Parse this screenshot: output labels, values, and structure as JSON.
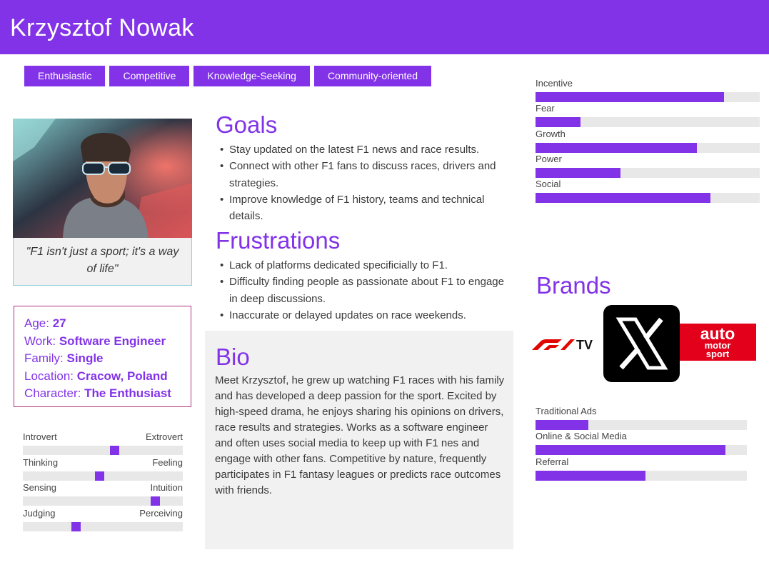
{
  "persona": {
    "name": "Krzysztof Nowak"
  },
  "tags": [
    "Enthusiastic",
    "Competitive",
    "Knowledge-Seeking",
    "Community-oriented"
  ],
  "quote": "\"F1 isn't just a sport; it's a way of life\"",
  "facts": {
    "age_label": "Age: ",
    "age": "27",
    "work_label": "Work: ",
    "work": "Software Engineer",
    "family_label": "Family: ",
    "family": "Single",
    "location_label": "Location: ",
    "location": "Cracow, Poland",
    "character_label": "Character: ",
    "character": "The Enthusiast"
  },
  "personality": [
    {
      "left": "Introvert",
      "right": "Extrovert",
      "value": 0.58
    },
    {
      "left": "Thinking",
      "right": "Feeling",
      "value": 0.48
    },
    {
      "left": "Sensing",
      "right": "Intuition",
      "value": 0.85
    },
    {
      "left": "Judging",
      "right": "Perceiving",
      "value": 0.32
    }
  ],
  "goals": {
    "title": "Goals",
    "items": [
      "Stay updated on the latest F1 news and race results.",
      "Connect with other F1 fans to discuss races, drivers and strategies.",
      "Improve knowledge of F1 history, teams and technical details."
    ]
  },
  "frustrations": {
    "title": "Frustrations",
    "items": [
      "Lack of platforms dedicated specificially to F1.",
      "Difficulty finding people as passionate about F1 to engage in deep discussions.",
      "Inaccurate or delayed updates on race weekends."
    ]
  },
  "bio": {
    "title": "Bio",
    "text": "Meet Krzysztof, he grew up watching F1 races with his family and has developed a deep passion for the sport. Excited by high-speed drama, he enjoys sharing his opinions on drivers, race results and strategies. Works as a software engineer and often uses social media to keep up with F1 nes and engage with other fans. Competitive by nature, frequently participates in F1 fantasy leagues or predicts race outcomes with friends."
  },
  "motivations": [
    {
      "label": "Incentive",
      "value": 0.84
    },
    {
      "label": "Fear",
      "value": 0.2
    },
    {
      "label": "Growth",
      "value": 0.72
    },
    {
      "label": "Power",
      "value": 0.38
    },
    {
      "label": "Social",
      "value": 0.78
    }
  ],
  "brands": {
    "title": "Brands",
    "logos": [
      {
        "name": "f1-tv-logo",
        "text": "TV"
      },
      {
        "name": "x-logo"
      },
      {
        "name": "auto-motor-sport-logo",
        "line1": "auto",
        "line2": "motor",
        "line3": "sport"
      }
    ]
  },
  "channels": [
    {
      "label": "Traditional Ads",
      "value": 0.25
    },
    {
      "label": "Online & Social Media",
      "value": 0.9
    },
    {
      "label": "Referral",
      "value": 0.52
    }
  ],
  "colors": {
    "accent": "#8233e8",
    "track": "#e8e8e8",
    "panel": "#f1f1f1"
  }
}
